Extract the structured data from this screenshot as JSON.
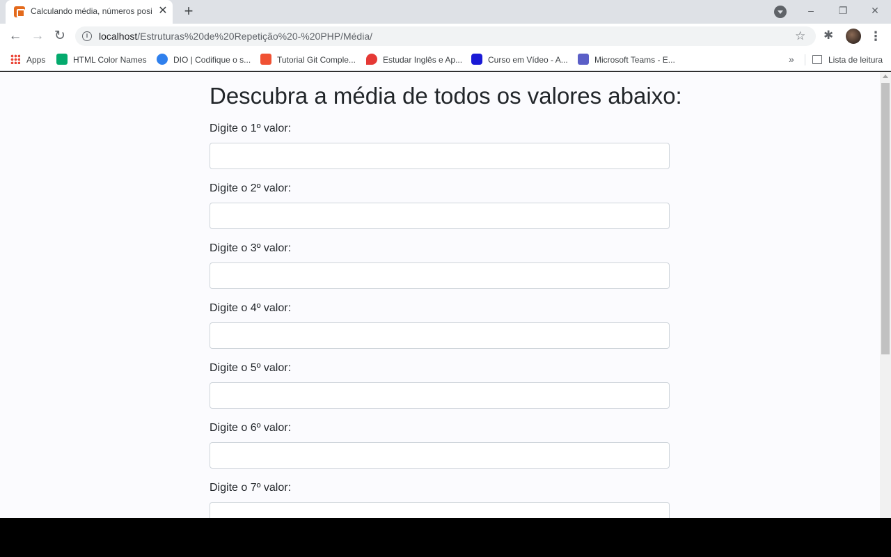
{
  "browser": {
    "tab_title": "Calculando média, números posi",
    "tab_close": "✕",
    "new_tab": "+",
    "window_controls": {
      "minimize": "–",
      "restore": "❐",
      "close": "✕"
    },
    "nav": {
      "back": "←",
      "forward": "→",
      "reload": "↻"
    },
    "url_host": "localhost",
    "url_path": "/Estruturas%20de%20Repetição%20-%20PHP/Média/",
    "info_glyph": "i",
    "star_glyph": "☆",
    "extensions_glyph": "✱",
    "menu_glyph": "⋮"
  },
  "bookmarks": {
    "items": [
      {
        "label": "Apps",
        "icon": "apps-grid-icon"
      },
      {
        "label": "HTML Color Names",
        "icon": "w3-icon",
        "color": "#04aa6d"
      },
      {
        "label": "DIO | Codifique o s...",
        "icon": "dio-icon",
        "color": "#2f80ed"
      },
      {
        "label": "Tutorial Git Comple...",
        "icon": "git-icon",
        "color": "#f05133"
      },
      {
        "label": "Estudar Inglês e Ap...",
        "icon": "pin-icon",
        "color": "#e53935"
      },
      {
        "label": "Curso em Vídeo - A...",
        "icon": "video-icon",
        "color": "#1a1ad6"
      },
      {
        "label": "Microsoft Teams - E...",
        "icon": "teams-icon",
        "color": "#5b5fc7"
      }
    ],
    "overflow": "»",
    "reading_list": "Lista de leitura"
  },
  "page": {
    "title": "Descubra a média de todos os valores abaixo:",
    "fields": [
      {
        "label": "Digite o 1º valor:",
        "value": ""
      },
      {
        "label": "Digite o 2º valor:",
        "value": ""
      },
      {
        "label": "Digite o 3º valor:",
        "value": ""
      },
      {
        "label": "Digite o 4º valor:",
        "value": ""
      },
      {
        "label": "Digite o 5º valor:",
        "value": ""
      },
      {
        "label": "Digite o 6º valor:",
        "value": ""
      },
      {
        "label": "Digite o 7º valor:",
        "value": ""
      }
    ]
  }
}
